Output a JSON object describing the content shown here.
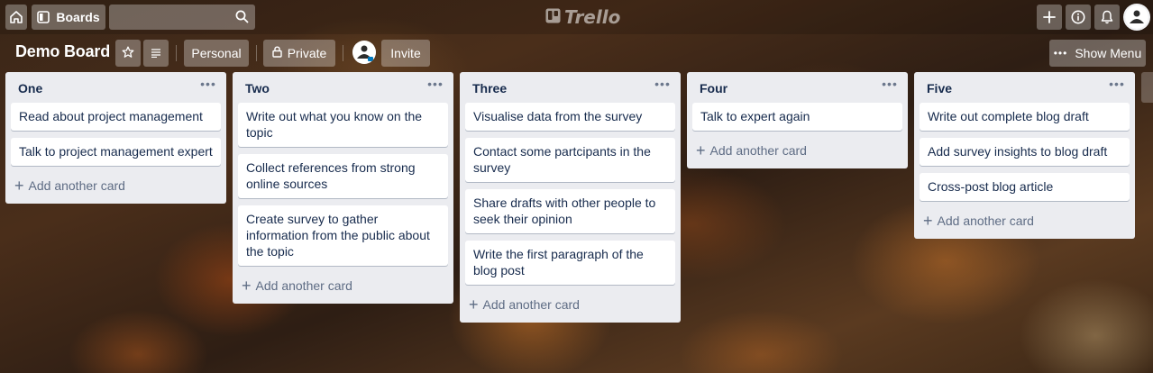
{
  "topbar": {
    "home_icon": "home-icon",
    "boards_label": "Boards",
    "search_placeholder": "",
    "logo_text": "Trello",
    "add_icon": "plus-icon",
    "info_icon": "info-icon",
    "notifications_icon": "bell-icon"
  },
  "board": {
    "title": "Demo Board",
    "team_label": "Personal",
    "visibility_label": "Private",
    "invite_label": "Invite",
    "show_menu_label": "Show Menu"
  },
  "lists": [
    {
      "title": "One",
      "cards": [
        "Read about project management",
        "Talk to project management expert"
      ],
      "add_label": "Add another card"
    },
    {
      "title": "Two",
      "cards": [
        "Write out what you know on the topic",
        "Collect references from strong online sources",
        "Create survey to gather information from the public about the topic"
      ],
      "add_label": "Add another card"
    },
    {
      "title": "Three",
      "cards": [
        "Visualise data from the survey",
        "Contact some partcipants in the survey",
        "Share drafts with other people to seek their opinion",
        "Write the first paragraph of the blog post"
      ],
      "add_label": "Add another card"
    },
    {
      "title": "Four",
      "cards": [
        "Talk to expert again"
      ],
      "add_label": "Add another card"
    },
    {
      "title": "Five",
      "cards": [
        "Write out complete blog draft",
        "Add survey insights to blog draft",
        "Cross-post blog article"
      ],
      "add_label": "Add another card"
    }
  ],
  "colors": {
    "list_bg": "#ebecf0",
    "card_text": "#172b4d",
    "muted_text": "#5e6c84"
  }
}
